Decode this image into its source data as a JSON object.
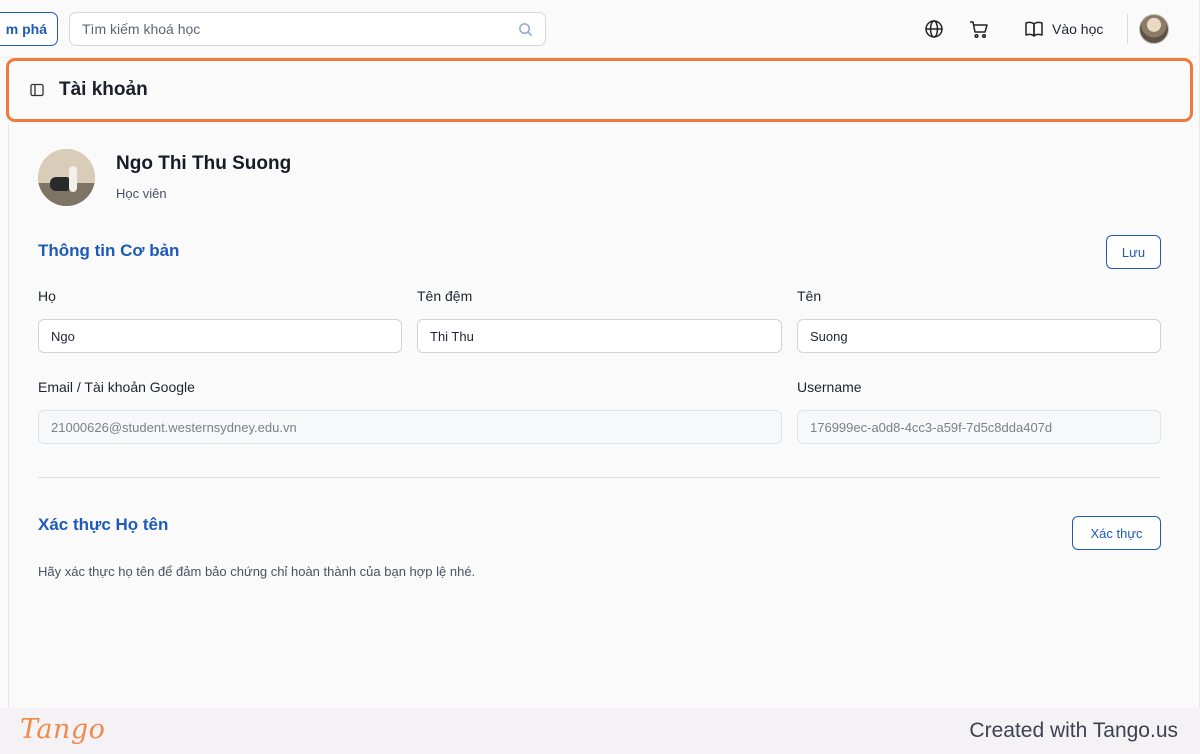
{
  "topbar": {
    "explore_label": "m phá",
    "search_placeholder": "Tìm kiếm khoá học",
    "learn_label": "Vào học"
  },
  "header": {
    "title": "Tài khoản"
  },
  "profile": {
    "name": "Ngo Thi Thu Suong",
    "role": "Học viên"
  },
  "basic_info": {
    "title": "Thông tin Cơ bản",
    "save_label": "Lưu",
    "last_name_label": "Họ",
    "last_name_value": "Ngo",
    "middle_name_label": "Tên đệm",
    "middle_name_value": "Thi Thu",
    "first_name_label": "Tên",
    "first_name_value": "Suong",
    "email_label": "Email / Tài khoản Google",
    "email_value": "21000626@student.westernsydney.edu.vn",
    "username_label": "Username",
    "username_value": "176999ec-a0d8-4cc3-a59f-7d5c8dda407d"
  },
  "verify": {
    "title": "Xác thực Họ tên",
    "button_label": "Xác thực",
    "hint": "Hãy xác thực họ tên để đảm bảo chứng chỉ hoàn thành của bạn hợp lệ nhé."
  },
  "footer": {
    "logo": "Tango",
    "credit": "Created with Tango.us"
  },
  "colors": {
    "accent": "#1e5bb8",
    "highlight": "#f07a3a",
    "tango": "#f08a4b"
  },
  "icons": [
    "search-icon",
    "globe-icon",
    "cart-icon",
    "book-icon",
    "sidebar-toggle-icon"
  ]
}
